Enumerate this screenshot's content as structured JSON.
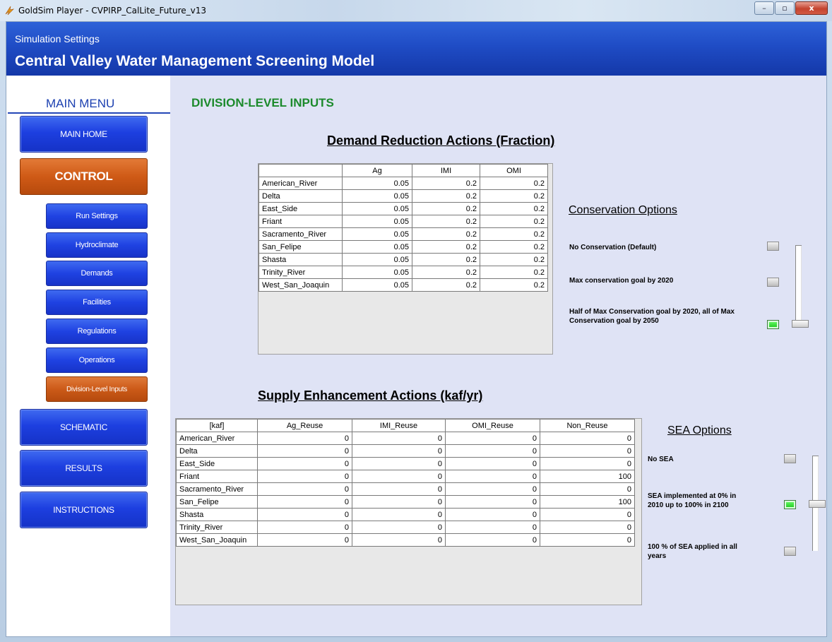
{
  "window": {
    "title": "GoldSim Player - CVPIRP_CalLite_Future_v13",
    "min": "–",
    "max": "▫",
    "close": "x"
  },
  "banner": {
    "subtitle": "Simulation Settings",
    "title": "Central Valley Water Management Screening Model"
  },
  "menu": {
    "title": "MAIN MENU",
    "main_home": "MAIN HOME",
    "control": "CONTROL",
    "sub": [
      "Run Settings",
      "Hydroclimate",
      "Demands",
      "Facilities",
      "Regulations",
      "Operations",
      "Division-Level Inputs"
    ],
    "schematic": "SCHEMATIC",
    "results": "RESULTS",
    "instructions": "INSTRUCTIONS"
  },
  "page": {
    "section_title": "DIVISION-LEVEL INPUTS"
  },
  "demand": {
    "title": "Demand Reduction Actions (Fraction)",
    "columns": [
      "",
      "Ag",
      "IMI",
      "OMI"
    ],
    "rows": [
      {
        "name": "American_River",
        "ag": "0.05",
        "imi": "0.2",
        "omi": "0.2"
      },
      {
        "name": "Delta",
        "ag": "0.05",
        "imi": "0.2",
        "omi": "0.2"
      },
      {
        "name": "East_Side",
        "ag": "0.05",
        "imi": "0.2",
        "omi": "0.2"
      },
      {
        "name": "Friant",
        "ag": "0.05",
        "imi": "0.2",
        "omi": "0.2"
      },
      {
        "name": "Sacramento_River",
        "ag": "0.05",
        "imi": "0.2",
        "omi": "0.2"
      },
      {
        "name": "San_Felipe",
        "ag": "0.05",
        "imi": "0.2",
        "omi": "0.2"
      },
      {
        "name": "Shasta",
        "ag": "0.05",
        "imi": "0.2",
        "omi": "0.2"
      },
      {
        "name": "Trinity_River",
        "ag": "0.05",
        "imi": "0.2",
        "omi": "0.2"
      },
      {
        "name": "West_San_Joaquin",
        "ag": "0.05",
        "imi": "0.2",
        "omi": "0.2"
      }
    ]
  },
  "conservation": {
    "title": "Conservation Options",
    "options": [
      {
        "label": "No Conservation (Default)",
        "selected": false
      },
      {
        "label": "Max conservation goal by 2020",
        "selected": false
      },
      {
        "label": "Half of Max Conservation goal by 2020, all of Max Conservation goal by 2050",
        "selected": true
      }
    ]
  },
  "supply": {
    "title": "Supply Enhancement Actions (kaf/yr)",
    "columns": [
      "[kaf]",
      "Ag_Reuse",
      "IMI_Reuse",
      "OMI_Reuse",
      "Non_Reuse"
    ],
    "rows": [
      {
        "name": "American_River",
        "ag": "0",
        "imi": "0",
        "omi": "0",
        "non": "0"
      },
      {
        "name": "Delta",
        "ag": "0",
        "imi": "0",
        "omi": "0",
        "non": "0"
      },
      {
        "name": "East_Side",
        "ag": "0",
        "imi": "0",
        "omi": "0",
        "non": "0"
      },
      {
        "name": "Friant",
        "ag": "0",
        "imi": "0",
        "omi": "0",
        "non": "100"
      },
      {
        "name": "Sacramento_River",
        "ag": "0",
        "imi": "0",
        "omi": "0",
        "non": "0"
      },
      {
        "name": "San_Felipe",
        "ag": "0",
        "imi": "0",
        "omi": "0",
        "non": "100"
      },
      {
        "name": "Shasta",
        "ag": "0",
        "imi": "0",
        "omi": "0",
        "non": "0"
      },
      {
        "name": "Trinity_River",
        "ag": "0",
        "imi": "0",
        "omi": "0",
        "non": "0"
      },
      {
        "name": "West_San_Joaquin",
        "ag": "0",
        "imi": "0",
        "omi": "0",
        "non": "0"
      }
    ]
  },
  "sea": {
    "title": "SEA Options",
    "options": [
      {
        "label": "No SEA",
        "selected": false
      },
      {
        "label": "SEA implemented at 0% in 2010 up to 100% in 2100",
        "selected": true
      },
      {
        "label": "100 % of SEA applied in all years",
        "selected": false
      }
    ]
  }
}
